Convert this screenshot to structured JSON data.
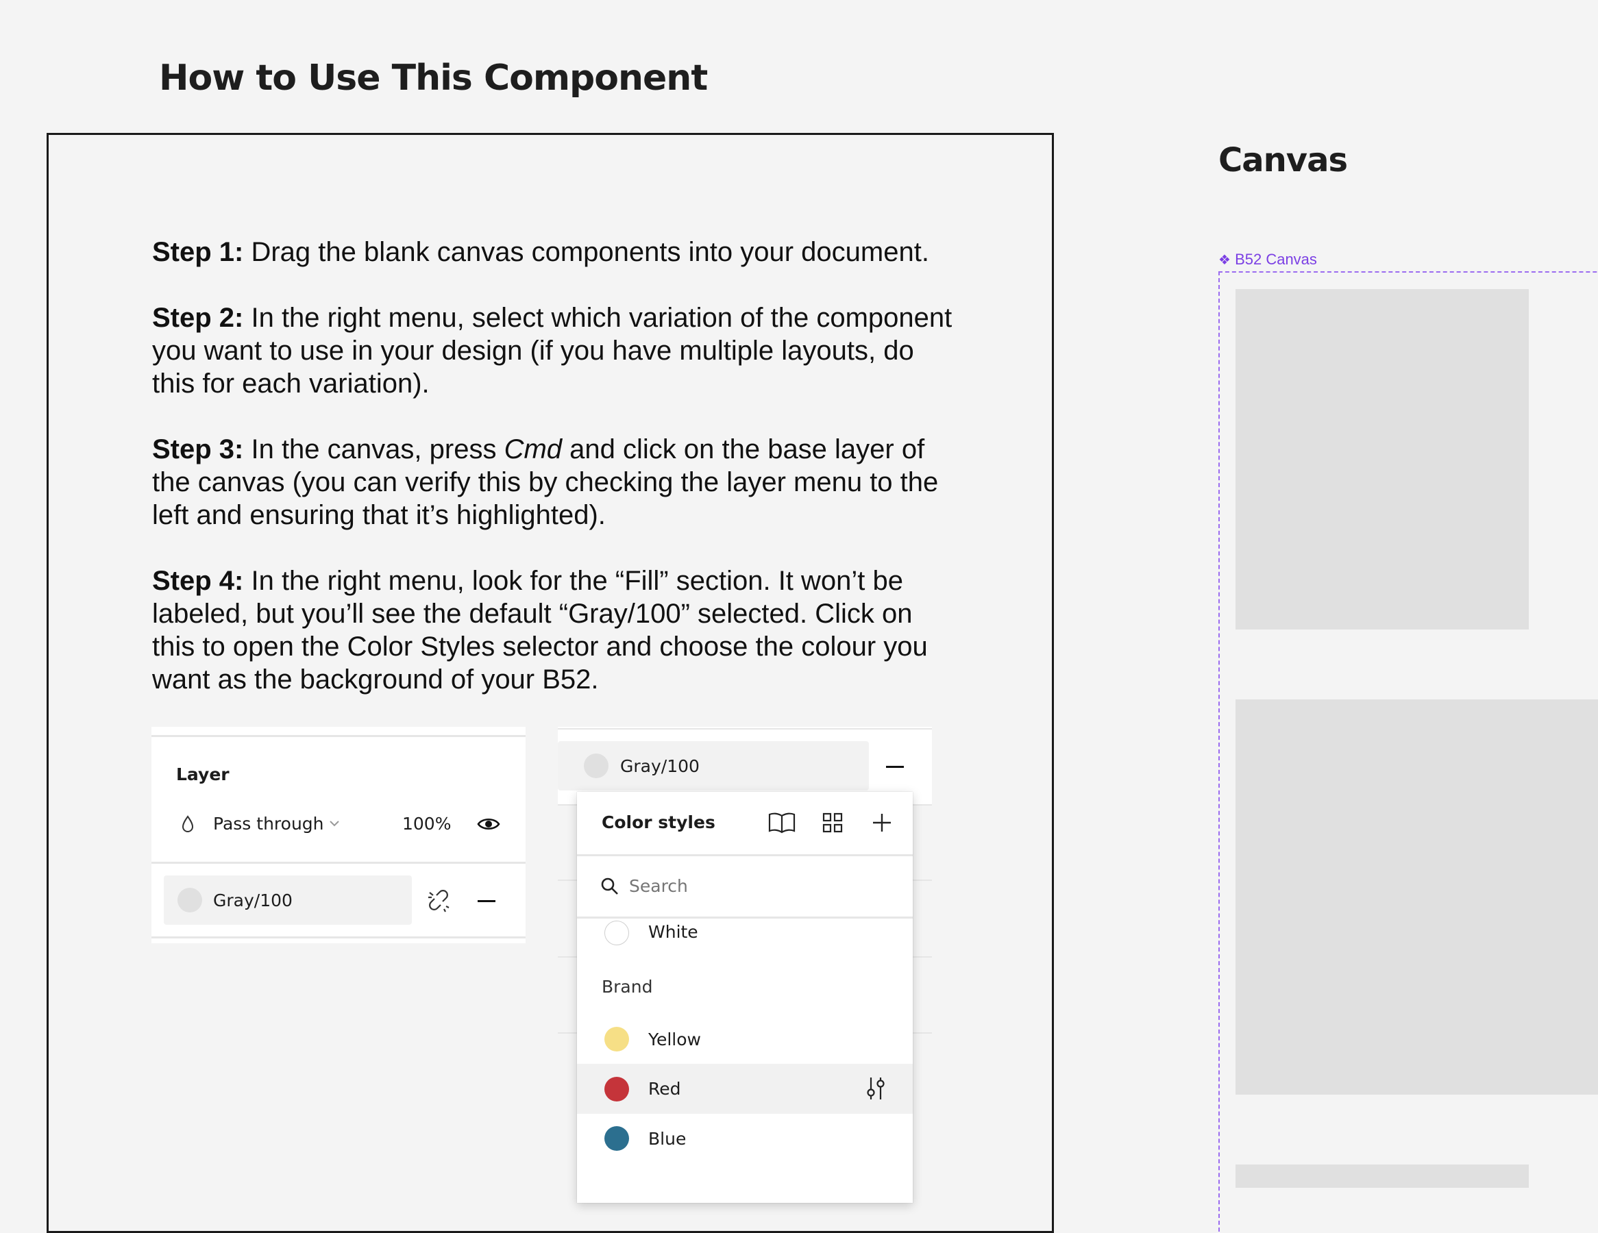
{
  "page": {
    "title": "How to Use This Component",
    "canvas_title": "Canvas"
  },
  "steps": [
    {
      "label": "Step 1:",
      "parts": [
        {
          "t": " Drag the blank canvas components into your document.",
          "em": false
        }
      ]
    },
    {
      "label": "Step 2:",
      "parts": [
        {
          "t": " In the right menu, select which variation of the component you want to use in your design (if you have multiple layouts, do this for each variation).",
          "em": false
        }
      ]
    },
    {
      "label": "Step 3:",
      "parts": [
        {
          "t": " In the canvas, press ",
          "em": false
        },
        {
          "t": "Cmd",
          "em": true
        },
        {
          "t": " and click on the base layer of the canvas (you can verify this by checking the layer menu to the left and ensuring that it’s highlighted).",
          "em": false
        }
      ]
    },
    {
      "label": "Step 4:",
      "parts": [
        {
          "t": " In the right menu, look for the “Fill” section. It won’t be labeled, but you’ll see the default “Gray/100” selected. Click on this to open the Color Styles selector and choose the colour you want as the background of your B52.",
          "em": false
        }
      ]
    }
  ],
  "layer_panel": {
    "title": "Layer",
    "blend_mode": "Pass through",
    "opacity": "100%",
    "fill_style": "Gray/100"
  },
  "fill_panel": {
    "fill_style": "Gray/100"
  },
  "color_styles": {
    "title": "Color styles",
    "search_placeholder": "Search",
    "items": [
      {
        "name": "White",
        "color": "#ffffff"
      }
    ],
    "group": "Brand",
    "brand_items": [
      {
        "name": "Yellow",
        "color": "#f6df86"
      },
      {
        "name": "Red",
        "color": "#c5343a"
      },
      {
        "name": "Blue",
        "color": "#2c6f8f"
      }
    ],
    "hovered": "Red"
  },
  "canvas": {
    "component_label": "B52 Canvas"
  },
  "colors": {
    "accent_purple": "#7b3fe4",
    "gray_100": "#e0e0e0"
  }
}
